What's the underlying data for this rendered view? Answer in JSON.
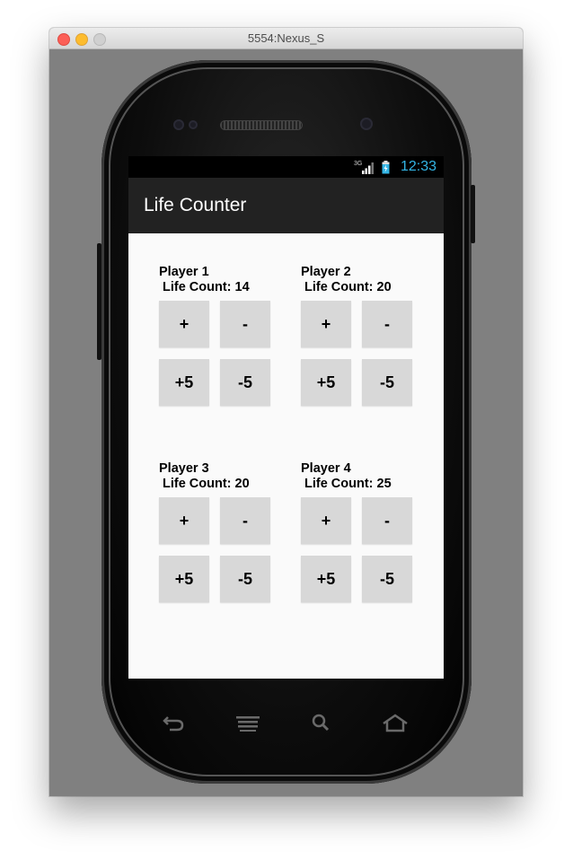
{
  "window": {
    "title": "5554:Nexus_S"
  },
  "status_bar": {
    "network": "3G",
    "time": "12:33"
  },
  "action_bar": {
    "title": "Life Counter"
  },
  "players": [
    {
      "name": "Player 1",
      "life_label": "Life Count: 14"
    },
    {
      "name": "Player 2",
      "life_label": "Life Count: 20"
    },
    {
      "name": "Player 3",
      "life_label": "Life Count: 20"
    },
    {
      "name": "Player 4",
      "life_label": "Life Count: 25"
    }
  ],
  "buttons": {
    "plus": "+",
    "minus": "-",
    "plus5": "+5",
    "minus5": "-5"
  },
  "nav_icons": [
    "back-icon",
    "menu-icon",
    "search-icon",
    "home-icon"
  ],
  "colors": {
    "clock": "#33b5e5",
    "action_bar": "#222222",
    "button": "#d8d8d8"
  }
}
